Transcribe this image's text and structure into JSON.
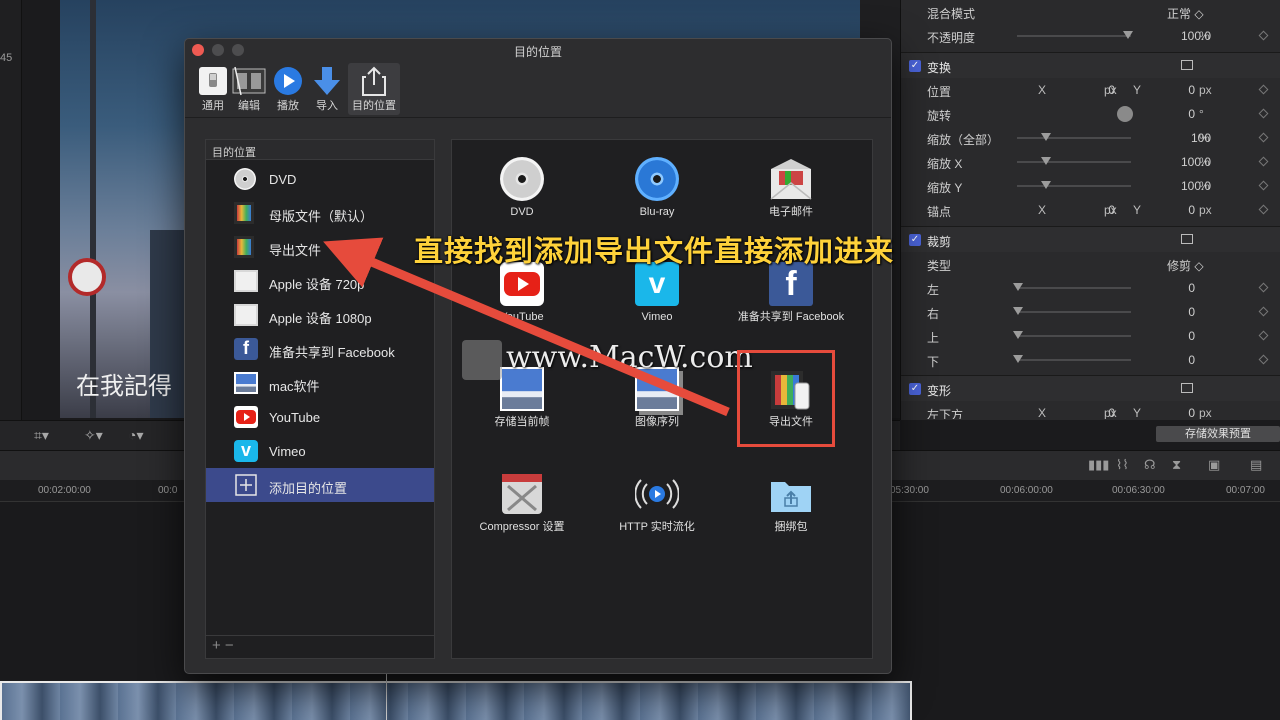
{
  "viewer": {
    "side_number": "45",
    "subtitle": "在我記得"
  },
  "inspector": {
    "blend_mode_label": "混合模式",
    "blend_mode_value": "正常 ◇",
    "opacity_label": "不透明度",
    "opacity_value": "100.0",
    "opacity_unit": "%",
    "transform_title": "变换",
    "position_label": "位置",
    "position_x": "0",
    "position_y": "0",
    "rotation_label": "旋转",
    "rotation_value": "0",
    "rotation_unit": "°",
    "scale_all_label": "缩放（全部）",
    "scale_all_value": "100",
    "scale_x_label": "缩放 X",
    "scale_x_value": "100.0",
    "scale_y_label": "缩放 Y",
    "scale_y_value": "100.0",
    "anchor_label": "锚点",
    "anchor_x": "0",
    "anchor_y": "0",
    "crop_title": "裁剪",
    "type_label": "类型",
    "type_value": "修剪 ◇",
    "left_label": "左",
    "left_value": "0",
    "right_label": "右",
    "right_value": "0",
    "top_label": "上",
    "top_value": "0",
    "bottom_label": "下",
    "bottom_value": "0",
    "distort_title": "变形",
    "bottom_left_label": "左下方",
    "bottom_left_x": "0",
    "bottom_left_y": "0",
    "x_label": "X",
    "y_label": "Y",
    "px_unit": "px",
    "pct_unit": "%",
    "save_preset": "存储效果预置",
    "check": "✓"
  },
  "timeline": {
    "ruler": [
      "00:02:00:00",
      "00:0",
      "05:30:00",
      "00:06:00:00",
      "00:06:30:00",
      "00:07:00"
    ]
  },
  "dialog": {
    "title": "目的位置",
    "toolbar": [
      {
        "label": "通用"
      },
      {
        "label": "编辑"
      },
      {
        "label": "播放"
      },
      {
        "label": "导入"
      },
      {
        "label": "目的位置"
      }
    ],
    "list_header": "目的位置",
    "list_items": [
      {
        "label": "DVD"
      },
      {
        "label": "母版文件（默认）"
      },
      {
        "label": "导出文件"
      },
      {
        "label": "Apple 设备 720p"
      },
      {
        "label": "Apple 设备 1080p"
      },
      {
        "label": "准备共享到 Facebook"
      },
      {
        "label": "mac软件"
      },
      {
        "label": "YouTube"
      },
      {
        "label": "Vimeo"
      },
      {
        "label": "添加目的位置"
      }
    ],
    "list_footer": "+ −",
    "grid_items": [
      {
        "label": "DVD"
      },
      {
        "label": "Blu-ray"
      },
      {
        "label": "电子邮件"
      },
      {
        "label": "YouTube"
      },
      {
        "label": "Vimeo"
      },
      {
        "label": "准备共享到 Facebook"
      },
      {
        "label": "存储当前帧"
      },
      {
        "label": "图像序列"
      },
      {
        "label": "导出文件"
      },
      {
        "label": "Compressor 设置"
      },
      {
        "label": "HTTP 实时流化"
      },
      {
        "label": "捆绑包"
      }
    ]
  },
  "annotation": {
    "text": "直接找到添加导出文件直接添加进来",
    "watermark": "www.MacW.com",
    "highlight_color": "#e64b3c",
    "arrow_color": "#e64b3c"
  }
}
